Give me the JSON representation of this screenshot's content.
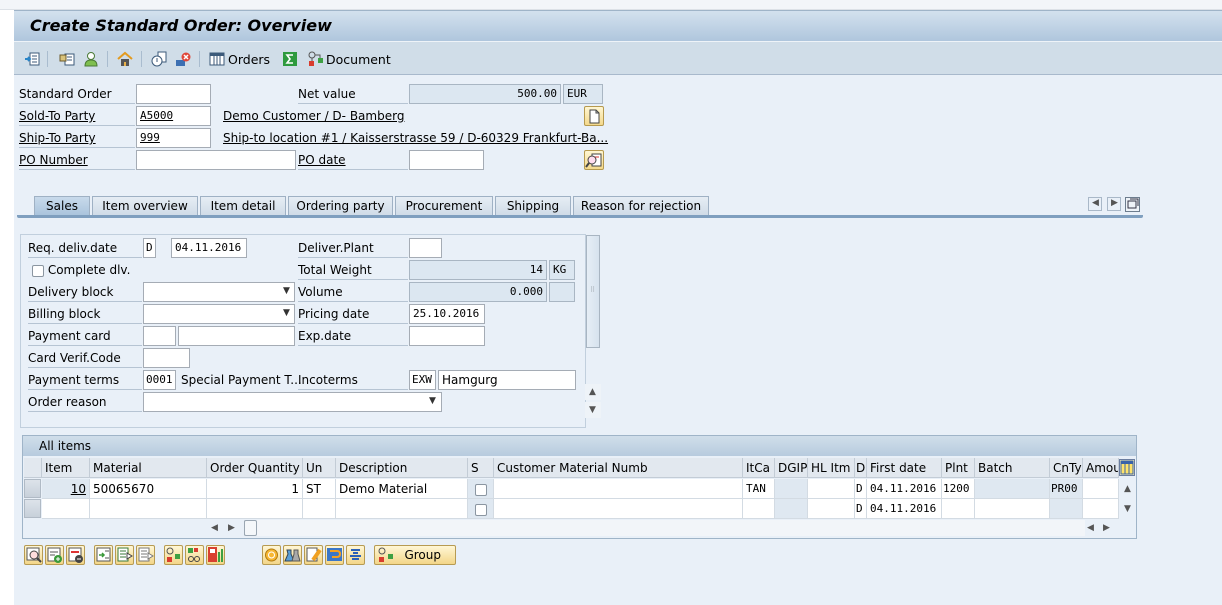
{
  "window": {
    "title": "Create Standard Order: Overview"
  },
  "toolbar": {
    "items": [
      {
        "icon": "display-doc-header-icon"
      },
      {
        "icon": "header-details-icon"
      },
      {
        "icon": "business-partner-icon"
      },
      {
        "icon": "home-org-data-icon"
      },
      {
        "icon": "document-flow-icon"
      },
      {
        "icon": "status-overview-icon"
      },
      {
        "icon": "orders-grid-icon",
        "label": "Orders"
      },
      {
        "icon": "sum-icon"
      },
      {
        "icon": "document-config-icon",
        "label": "Document"
      }
    ]
  },
  "header": {
    "standard_order": {
      "label": "Standard Order",
      "value": ""
    },
    "net_value": {
      "label": "Net value",
      "value": "500.00",
      "currency": "EUR"
    },
    "sold_to": {
      "label": "Sold-To Party",
      "value": "A5000",
      "description": "Demo Customer / D- Bamberg"
    },
    "ship_to": {
      "label": "Ship-To Party",
      "value": "999",
      "description": "Ship-to location #1 / Kaisserstrasse 59 / D-60329 Frankfurt-Ba..."
    },
    "po_number": {
      "label": "PO Number",
      "value": ""
    },
    "po_date": {
      "label": "PO date",
      "value": ""
    }
  },
  "tabs": [
    {
      "label": "Sales",
      "active": true
    },
    {
      "label": "Item overview"
    },
    {
      "label": "Item detail"
    },
    {
      "label": "Ordering party"
    },
    {
      "label": "Procurement"
    },
    {
      "label": "Shipping"
    },
    {
      "label": "Reason for rejection"
    }
  ],
  "sales": {
    "req_deliv_date": {
      "label": "Req. deliv.date",
      "format": "D",
      "value": "04.11.2016"
    },
    "complete_dlv": {
      "label": "Complete dlv.",
      "checked": false
    },
    "delivery_block": {
      "label": "Delivery block",
      "value": ""
    },
    "billing_block": {
      "label": "Billing block",
      "value": ""
    },
    "payment_card": {
      "label": "Payment card",
      "type": "",
      "value": ""
    },
    "card_verif_code": {
      "label": "Card Verif.Code",
      "value": ""
    },
    "payment_terms": {
      "label": "Payment terms",
      "value": "0001",
      "description": "Special Payment T..."
    },
    "order_reason": {
      "label": "Order reason",
      "value": ""
    },
    "deliver_plant": {
      "label": "Deliver.Plant",
      "value": ""
    },
    "total_weight": {
      "label": "Total Weight",
      "value": "14",
      "unit": "KG"
    },
    "volume": {
      "label": "Volume",
      "value": "0.000",
      "unit": ""
    },
    "pricing_date": {
      "label": "Pricing date",
      "value": "25.10.2016"
    },
    "exp_date": {
      "label": "Exp.date",
      "value": ""
    },
    "incoterms": {
      "label": "Incoterms",
      "code": "EXW",
      "value": "Hamgurg"
    }
  },
  "items_table": {
    "caption": "All items",
    "columns": [
      "Item",
      "Material",
      "Order Quantity",
      "Un",
      "Description",
      "S",
      "Customer Material Numb",
      "ItCa",
      "DGIP",
      "HL Itm",
      "D",
      "First date",
      "Plnt",
      "Batch",
      "CnTy",
      "Amou"
    ],
    "rows": [
      {
        "item": "10",
        "material": "50065670",
        "qty": "1",
        "un": "ST",
        "description": "Demo Material",
        "s": false,
        "cust_mat": "",
        "itca": "TAN",
        "dgip": "",
        "hl": "",
        "d": "D",
        "first_date": "04.11.2016",
        "plnt": "1200",
        "batch": "",
        "cnty": "PR00",
        "amou": ""
      },
      {
        "item": "",
        "material": "",
        "qty": "",
        "un": "",
        "description": "",
        "s": false,
        "cust_mat": "",
        "itca": "",
        "dgip": "",
        "hl": "",
        "d": "D",
        "first_date": "04.11.2016",
        "plnt": "",
        "batch": "",
        "cnty": "",
        "amou": ""
      }
    ]
  },
  "bottom_toolbar": {
    "group_label": "Group",
    "buttons": [
      "item-details-icon",
      "insert-row-icon",
      "delete-row-icon",
      "select-all-icon",
      "select-block-icon",
      "deselect-all-icon",
      "configuration-icon",
      "item-availability-icon",
      "item-conditions-icon",
      "reschedule-icon",
      "batch-split-icon",
      "edit-item-icon",
      "substitution-icon",
      "sort-icon"
    ]
  }
}
